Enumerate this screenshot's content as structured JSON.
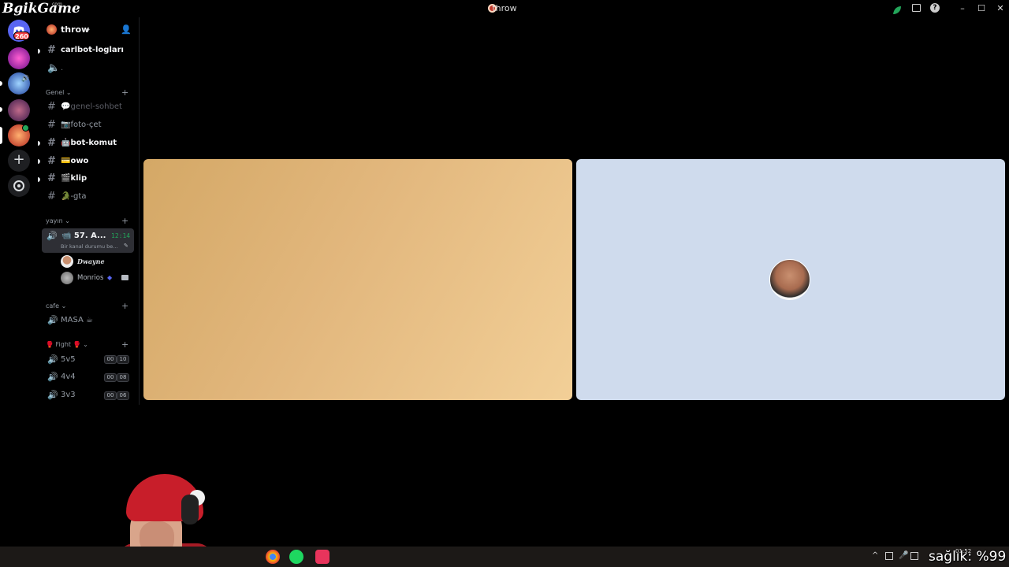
{
  "window": {
    "title": "throw"
  },
  "watermark": {
    "text": "BgikGame",
    "sub": "com"
  },
  "servers": {
    "badge": "260"
  },
  "server": {
    "name": "throw"
  },
  "channels_top": [
    {
      "label": "carlbot-logları",
      "type": "text",
      "state": "unread"
    },
    {
      "label": ".",
      "type": "voice",
      "state": "muted"
    }
  ],
  "categories": {
    "genel": "Genel",
    "yayin": "yayın",
    "cafe": "cafe",
    "fight": "🥊 Fight 🥊"
  },
  "channels_genel": [
    {
      "label": "💬genel-sohbet",
      "state": "muted"
    },
    {
      "label": "📷foto-çet",
      "state": "normal"
    },
    {
      "label": "🤖bot-komut",
      "state": "unread"
    },
    {
      "label": "💳owo",
      "state": "unread"
    },
    {
      "label": "🎬klip",
      "state": "unread"
    },
    {
      "label": "🐊-gta",
      "state": "normal"
    }
  ],
  "voice_active": {
    "label": "📹 57. A...",
    "timer": "12:14",
    "status": "Bir kanal durumu be...",
    "members": [
      {
        "name": "Dwayne"
      },
      {
        "name": "Monrios"
      }
    ]
  },
  "channels_cafe": [
    {
      "label": "MASA ☕"
    }
  ],
  "channels_fight": [
    {
      "label": "5v5",
      "a": "00",
      "b": "10"
    },
    {
      "label": "4v4",
      "a": "00",
      "b": "08"
    },
    {
      "label": "3v3",
      "a": "00",
      "b": "06"
    }
  ],
  "overlay": {
    "text": "sağlık: %99"
  },
  "taskbar": {
    "clock": "01:52"
  },
  "colors": {
    "accent_green": "#23a55a",
    "badge_red": "#f23f43",
    "tile_beige": "#e2b77d",
    "tile_blue": "#cfdbed"
  }
}
